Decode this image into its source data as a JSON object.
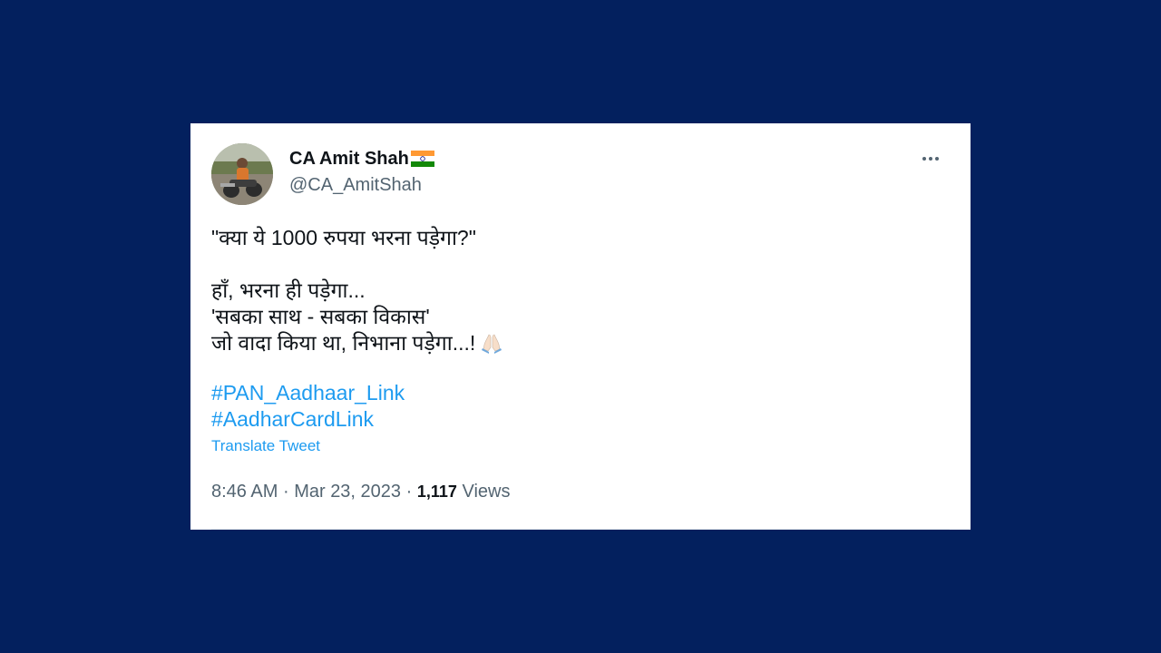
{
  "tweet": {
    "author": {
      "name": "CA Amit Shah",
      "flag_icon": "india-flag-icon",
      "handle": "@CA_AmitShah"
    },
    "menu_icon": "more-options-icon",
    "lines": {
      "quote": "\"क्या ये 1000 रुपया भरना पड़ेगा?\"",
      "line2": "हाँ, भरना ही पड़ेगा...",
      "line3": "'सबका साथ - सबका विकास'",
      "line4": "जो वादा किया था, निभाना पड़ेगा...!",
      "emoji_icon": "folded-hands-icon"
    },
    "hashtags": [
      "#PAN_Aadhaar_Link",
      "#AadharCardLink"
    ],
    "translate_label": "Translate Tweet",
    "time": "8:46 AM",
    "date": "Mar 23, 2023",
    "separator": "·",
    "views_count": "1,117",
    "views_label": "Views"
  },
  "colors": {
    "page_background": "#03205e",
    "link": "#1d9bf0",
    "secondary_text": "#536471",
    "primary_text": "#0f1419"
  }
}
